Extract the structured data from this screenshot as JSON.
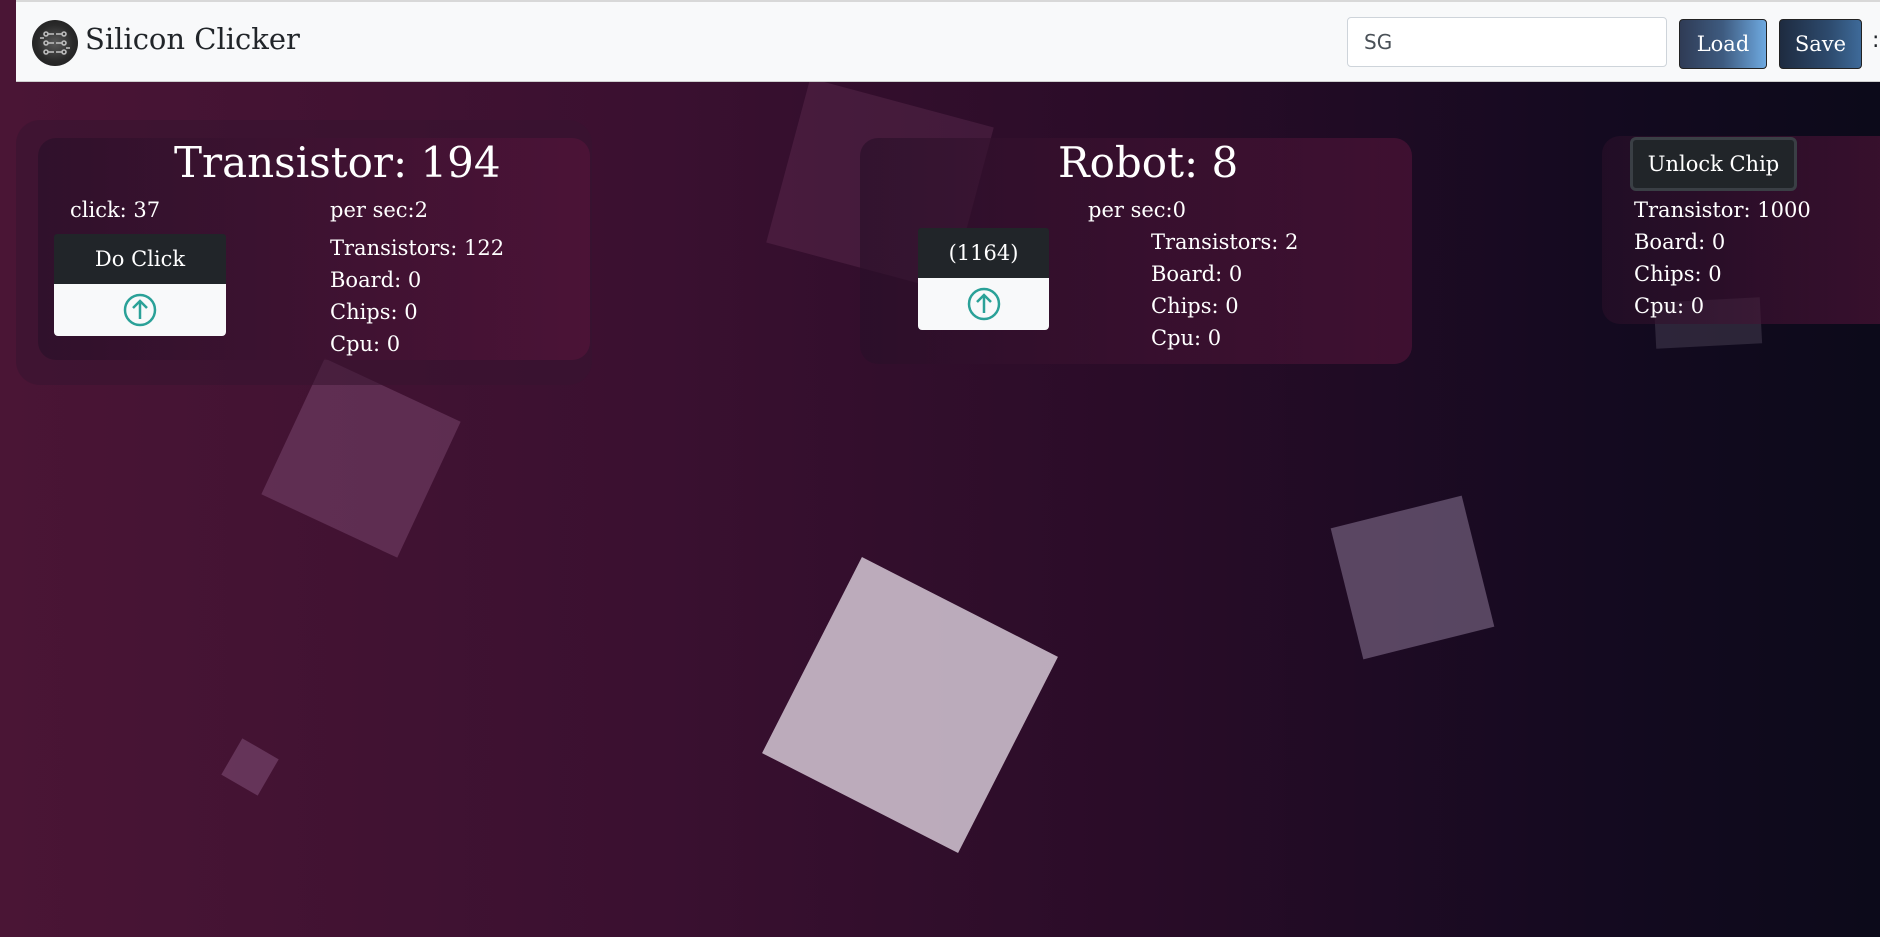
{
  "header": {
    "brand": "Silicon Clicker",
    "save_code_value": "SG",
    "load_label": "Load",
    "save_label": "Save",
    "edge_glyph": ":"
  },
  "transistor_panel": {
    "title": "Transistor: 194",
    "click_label": "click: 37",
    "per_sec_label": "per sec:2",
    "do_click_label": "Do Click",
    "costs": [
      "Transistors: 122",
      "Board: 0",
      "Chips: 0",
      "Cpu: 0"
    ]
  },
  "robot_panel": {
    "title": "Robot: 8",
    "per_sec_label": "per sec:0",
    "buy_label": "(1164)",
    "costs": [
      "Transistors: 2",
      "Board: 0",
      "Chips: 0",
      "Cpu: 0"
    ]
  },
  "chip_panel": {
    "unlock_label": "Unlock Chip",
    "costs": [
      "Transistor: 1000",
      "Board: 0",
      "Chips: 0",
      "Cpu: 0"
    ]
  },
  "colors": {
    "upgrade_icon": "#2aa198",
    "bg_left": "#4a1535",
    "bg_right": "#0c0a1a"
  },
  "icons": {
    "upgrade": "arrow-up-circle-icon",
    "logo": "circuit-logo-icon"
  }
}
